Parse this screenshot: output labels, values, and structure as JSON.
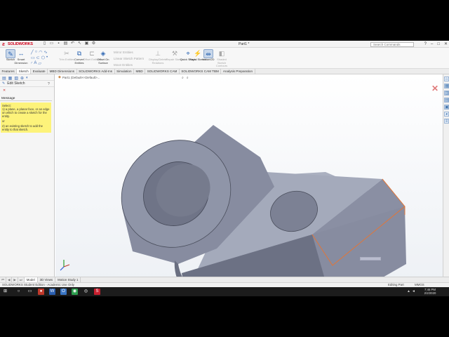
{
  "app": {
    "brand": "SOLIDWORKS",
    "document_title": "Part1 *",
    "search_placeholder": "Search Commands",
    "window_controls": [
      "?",
      "–",
      "□",
      "✕"
    ]
  },
  "ribbon": {
    "sketch": "Sketch",
    "smart_dimension": "Smart Dimension",
    "trim": "Trim Entities",
    "convert": "Convert Entities",
    "offset": "Offset Entities",
    "offset_surface": "Offset On Surface",
    "mirror": "Mirror Entities",
    "linear_pattern": "Linear Sketch Pattern",
    "move": "Move Entities",
    "display_delete": "Display/Delete Relations",
    "repair": "Repair Sketch",
    "quick_snaps": "Quick Snaps",
    "rapid_sketch": "Rapid Sketch",
    "instant2d": "Instant2D",
    "shaded_contours": "Shaded Sketch Contours"
  },
  "tabs": [
    "Features",
    "Sketch",
    "Evaluate",
    "MBD Dimensions",
    "SOLIDWORKS Add-Ins",
    "Simulation",
    "MBD",
    "SOLIDWORKS CAM",
    "SOLIDWORKS CAM TBM",
    "Analysis Preparation"
  ],
  "left_panel": {
    "title": "Edit Sketch",
    "message_header": "Message",
    "message_line1": "Select:",
    "message_line2": "1) a plane, a planar face, or an edge on which to create a sketch for the entity.",
    "message_or": "or",
    "message_line3": "2) an existing sketch to add the entity to that sketch."
  },
  "viewport": {
    "breadcrumb": "Part1 (Default<<Default>..."
  },
  "bottom_tabs": [
    "Model",
    "3D Views",
    "Motion Study 1"
  ],
  "status": {
    "left": "SOLIDWORKS Student Edition - Academic Use Only",
    "mode": "Editing Part",
    "units": "MMGS"
  },
  "taskbar": {
    "time": "7:46 PM",
    "date": "2/2/2020"
  },
  "colors": {
    "model_face": "#8e93a6",
    "model_top": "#b0b4c4",
    "model_dark": "#636879",
    "edge_highlight": "#e0763a"
  }
}
